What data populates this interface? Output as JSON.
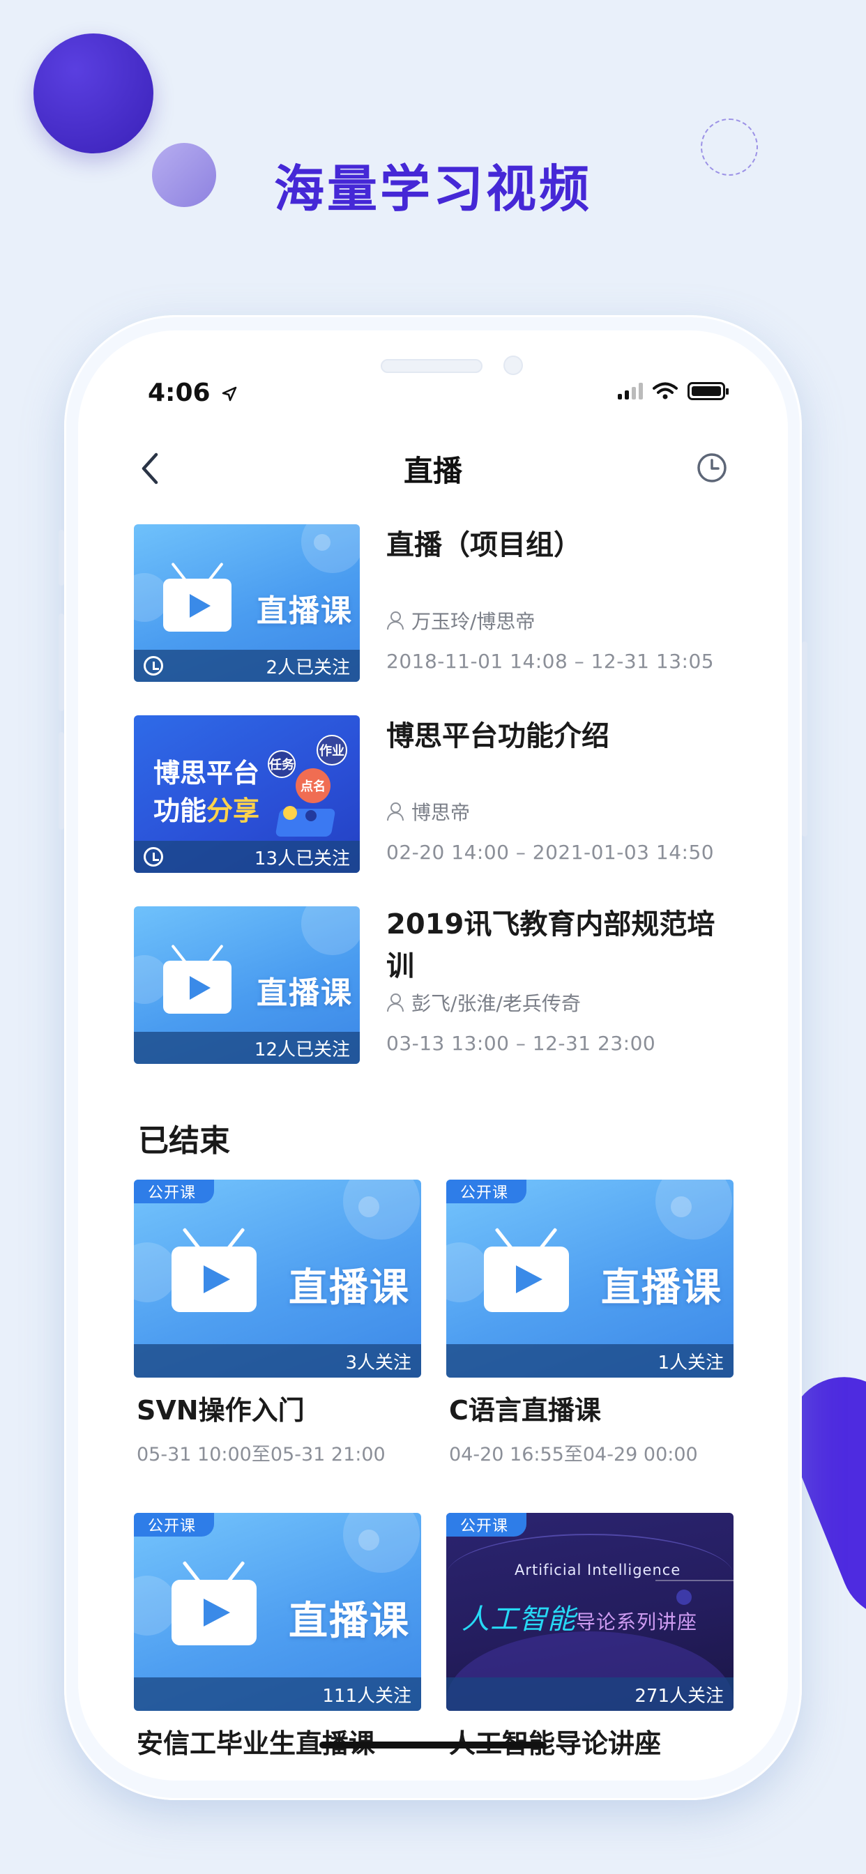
{
  "promo": {
    "headline": "海量学习视频"
  },
  "status_bar": {
    "time": "4:06"
  },
  "nav": {
    "title": "直播",
    "back_icon": "chevron-left-icon",
    "history_icon": "clock-icon"
  },
  "live_list": [
    {
      "title": "直播（项目组）",
      "author": "万玉玲/博思帝",
      "time": "2018-11-01 14:08 – 12-31 13:05",
      "followers": "2人已关注",
      "thumb_text": "直播课",
      "reminder": true
    },
    {
      "title": "博思平台功能介绍",
      "author": "博思帝",
      "time": "02-20 14:00 – 2021-01-03 14:50",
      "followers": "13人已关注",
      "thumb_line1": "博思平台",
      "thumb_line2a": "功能",
      "thumb_line2b": "分享",
      "tags": [
        "任务",
        "作业",
        "点名"
      ],
      "reminder": true
    },
    {
      "title": "2019讯飞教育内部规范培训",
      "author": "彭飞/张淮/老兵传奇",
      "time": "03-13 13:00 – 12-31 23:00",
      "followers": "12人已关注",
      "thumb_text": "直播课",
      "reminder": false
    }
  ],
  "ended_section": {
    "title": "已结束"
  },
  "ended_cards": [
    {
      "badge": "公开课",
      "title": "SVN操作入门",
      "time": "05-31 10:00至05-31 21:00",
      "followers": "3人关注",
      "thumb_text": "直播课"
    },
    {
      "badge": "公开课",
      "title": "C语言直播课",
      "time": "04-20 16:55至04-29 00:00",
      "followers": "1人关注",
      "thumb_text": "直播课"
    },
    {
      "badge": "公开课",
      "title": "安信工毕业生直播课",
      "followers": "111人关注",
      "thumb_text": "直播课"
    },
    {
      "badge": "公开课",
      "title": "人工智能导论讲座",
      "followers": "271人关注",
      "ai_en": "Artificial Intelligence",
      "ai_cn": "人工智能",
      "ai_cn_sub": "导论系列讲座"
    }
  ],
  "colors": {
    "accent": "#4528d6",
    "thumb_blue": "#4a9cf0",
    "badge_blue": "#2e7de8",
    "text_secondary": "#8b8f98"
  }
}
